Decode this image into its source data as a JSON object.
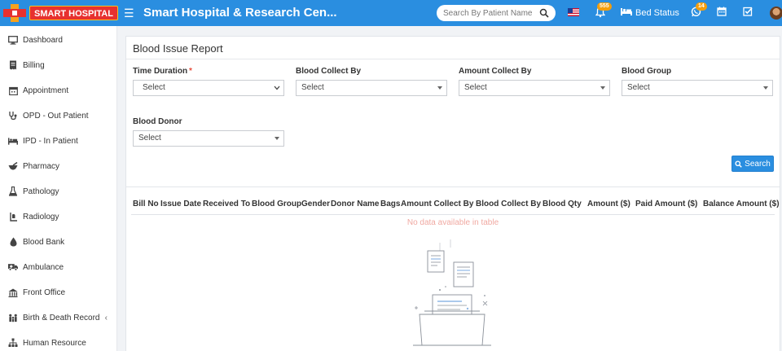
{
  "app": {
    "logo_text": "SMART HOSPITAL",
    "title": "Smart Hospital & Research Cen...",
    "search_placeholder": "Search By Patient Name",
    "notification_count": "555",
    "bed_status_label": "Bed Status",
    "whatsapp_count": "14"
  },
  "sidebar": {
    "items": [
      {
        "label": "Dashboard",
        "icon": "monitor-icon"
      },
      {
        "label": "Billing",
        "icon": "receipt-icon"
      },
      {
        "label": "Appointment",
        "icon": "calendar-icon"
      },
      {
        "label": "OPD - Out Patient",
        "icon": "stethoscope-icon"
      },
      {
        "label": "IPD - In Patient",
        "icon": "bed-icon"
      },
      {
        "label": "Pharmacy",
        "icon": "mortar-pestle-icon"
      },
      {
        "label": "Pathology",
        "icon": "flask-icon"
      },
      {
        "label": "Radiology",
        "icon": "xray-icon"
      },
      {
        "label": "Blood Bank",
        "icon": "blood-drop-icon"
      },
      {
        "label": "Ambulance",
        "icon": "ambulance-icon"
      },
      {
        "label": "Front Office",
        "icon": "building-icon"
      },
      {
        "label": "Birth & Death Record",
        "icon": "family-icon",
        "has_submenu": true
      },
      {
        "label": "Human Resource",
        "icon": "org-chart-icon"
      }
    ]
  },
  "report": {
    "title": "Blood Issue Report",
    "filters": {
      "time_duration": {
        "label": "Time Duration",
        "required_mark": "*",
        "value": "Select"
      },
      "blood_collect_by": {
        "label": "Blood Collect By",
        "value": "Select"
      },
      "amount_collect_by": {
        "label": "Amount Collect By",
        "value": "Select"
      },
      "blood_group": {
        "label": "Blood Group",
        "value": "Select"
      },
      "blood_donor": {
        "label": "Blood Donor",
        "value": "Select"
      }
    },
    "search_label": "Search",
    "columns": [
      "Bill No",
      "Issue Date",
      "Received To",
      "Blood Group",
      "Gender",
      "Donor Name",
      "Bags",
      "Amount Collect By",
      "Blood Collect By",
      "Blood Qty",
      "Amount ($)",
      "Paid Amount ($)",
      "Balance Amount ($)"
    ],
    "empty_message": "No data available in table"
  },
  "colors": {
    "primary": "#2a8ee0",
    "badge": "#f59e0b",
    "logo_red": "#e7312f",
    "empty_text": "#f0a9a2"
  }
}
